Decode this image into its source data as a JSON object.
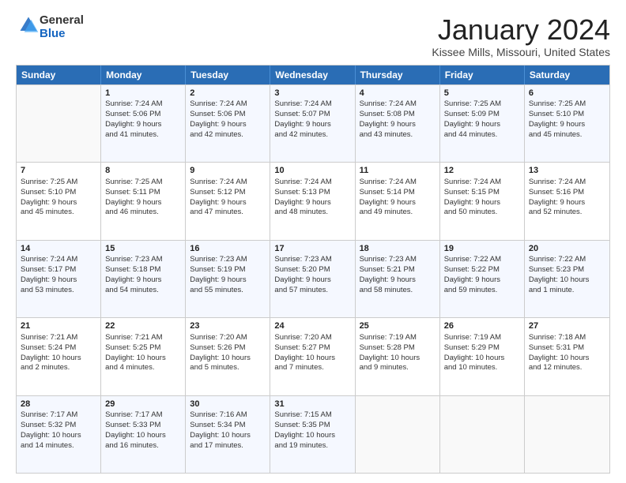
{
  "logo": {
    "general": "General",
    "blue": "Blue"
  },
  "title": "January 2024",
  "location": "Kissee Mills, Missouri, United States",
  "weekdays": [
    "Sunday",
    "Monday",
    "Tuesday",
    "Wednesday",
    "Thursday",
    "Friday",
    "Saturday"
  ],
  "rows": [
    [
      {
        "day": "",
        "lines": []
      },
      {
        "day": "1",
        "lines": [
          "Sunrise: 7:24 AM",
          "Sunset: 5:06 PM",
          "Daylight: 9 hours",
          "and 41 minutes."
        ]
      },
      {
        "day": "2",
        "lines": [
          "Sunrise: 7:24 AM",
          "Sunset: 5:06 PM",
          "Daylight: 9 hours",
          "and 42 minutes."
        ]
      },
      {
        "day": "3",
        "lines": [
          "Sunrise: 7:24 AM",
          "Sunset: 5:07 PM",
          "Daylight: 9 hours",
          "and 42 minutes."
        ]
      },
      {
        "day": "4",
        "lines": [
          "Sunrise: 7:24 AM",
          "Sunset: 5:08 PM",
          "Daylight: 9 hours",
          "and 43 minutes."
        ]
      },
      {
        "day": "5",
        "lines": [
          "Sunrise: 7:25 AM",
          "Sunset: 5:09 PM",
          "Daylight: 9 hours",
          "and 44 minutes."
        ]
      },
      {
        "day": "6",
        "lines": [
          "Sunrise: 7:25 AM",
          "Sunset: 5:10 PM",
          "Daylight: 9 hours",
          "and 45 minutes."
        ]
      }
    ],
    [
      {
        "day": "7",
        "lines": [
          "Sunrise: 7:25 AM",
          "Sunset: 5:10 PM",
          "Daylight: 9 hours",
          "and 45 minutes."
        ]
      },
      {
        "day": "8",
        "lines": [
          "Sunrise: 7:25 AM",
          "Sunset: 5:11 PM",
          "Daylight: 9 hours",
          "and 46 minutes."
        ]
      },
      {
        "day": "9",
        "lines": [
          "Sunrise: 7:24 AM",
          "Sunset: 5:12 PM",
          "Daylight: 9 hours",
          "and 47 minutes."
        ]
      },
      {
        "day": "10",
        "lines": [
          "Sunrise: 7:24 AM",
          "Sunset: 5:13 PM",
          "Daylight: 9 hours",
          "and 48 minutes."
        ]
      },
      {
        "day": "11",
        "lines": [
          "Sunrise: 7:24 AM",
          "Sunset: 5:14 PM",
          "Daylight: 9 hours",
          "and 49 minutes."
        ]
      },
      {
        "day": "12",
        "lines": [
          "Sunrise: 7:24 AM",
          "Sunset: 5:15 PM",
          "Daylight: 9 hours",
          "and 50 minutes."
        ]
      },
      {
        "day": "13",
        "lines": [
          "Sunrise: 7:24 AM",
          "Sunset: 5:16 PM",
          "Daylight: 9 hours",
          "and 52 minutes."
        ]
      }
    ],
    [
      {
        "day": "14",
        "lines": [
          "Sunrise: 7:24 AM",
          "Sunset: 5:17 PM",
          "Daylight: 9 hours",
          "and 53 minutes."
        ]
      },
      {
        "day": "15",
        "lines": [
          "Sunrise: 7:23 AM",
          "Sunset: 5:18 PM",
          "Daylight: 9 hours",
          "and 54 minutes."
        ]
      },
      {
        "day": "16",
        "lines": [
          "Sunrise: 7:23 AM",
          "Sunset: 5:19 PM",
          "Daylight: 9 hours",
          "and 55 minutes."
        ]
      },
      {
        "day": "17",
        "lines": [
          "Sunrise: 7:23 AM",
          "Sunset: 5:20 PM",
          "Daylight: 9 hours",
          "and 57 minutes."
        ]
      },
      {
        "day": "18",
        "lines": [
          "Sunrise: 7:23 AM",
          "Sunset: 5:21 PM",
          "Daylight: 9 hours",
          "and 58 minutes."
        ]
      },
      {
        "day": "19",
        "lines": [
          "Sunrise: 7:22 AM",
          "Sunset: 5:22 PM",
          "Daylight: 9 hours",
          "and 59 minutes."
        ]
      },
      {
        "day": "20",
        "lines": [
          "Sunrise: 7:22 AM",
          "Sunset: 5:23 PM",
          "Daylight: 10 hours",
          "and 1 minute."
        ]
      }
    ],
    [
      {
        "day": "21",
        "lines": [
          "Sunrise: 7:21 AM",
          "Sunset: 5:24 PM",
          "Daylight: 10 hours",
          "and 2 minutes."
        ]
      },
      {
        "day": "22",
        "lines": [
          "Sunrise: 7:21 AM",
          "Sunset: 5:25 PM",
          "Daylight: 10 hours",
          "and 4 minutes."
        ]
      },
      {
        "day": "23",
        "lines": [
          "Sunrise: 7:20 AM",
          "Sunset: 5:26 PM",
          "Daylight: 10 hours",
          "and 5 minutes."
        ]
      },
      {
        "day": "24",
        "lines": [
          "Sunrise: 7:20 AM",
          "Sunset: 5:27 PM",
          "Daylight: 10 hours",
          "and 7 minutes."
        ]
      },
      {
        "day": "25",
        "lines": [
          "Sunrise: 7:19 AM",
          "Sunset: 5:28 PM",
          "Daylight: 10 hours",
          "and 9 minutes."
        ]
      },
      {
        "day": "26",
        "lines": [
          "Sunrise: 7:19 AM",
          "Sunset: 5:29 PM",
          "Daylight: 10 hours",
          "and 10 minutes."
        ]
      },
      {
        "day": "27",
        "lines": [
          "Sunrise: 7:18 AM",
          "Sunset: 5:31 PM",
          "Daylight: 10 hours",
          "and 12 minutes."
        ]
      }
    ],
    [
      {
        "day": "28",
        "lines": [
          "Sunrise: 7:17 AM",
          "Sunset: 5:32 PM",
          "Daylight: 10 hours",
          "and 14 minutes."
        ]
      },
      {
        "day": "29",
        "lines": [
          "Sunrise: 7:17 AM",
          "Sunset: 5:33 PM",
          "Daylight: 10 hours",
          "and 16 minutes."
        ]
      },
      {
        "day": "30",
        "lines": [
          "Sunrise: 7:16 AM",
          "Sunset: 5:34 PM",
          "Daylight: 10 hours",
          "and 17 minutes."
        ]
      },
      {
        "day": "31",
        "lines": [
          "Sunrise: 7:15 AM",
          "Sunset: 5:35 PM",
          "Daylight: 10 hours",
          "and 19 minutes."
        ]
      },
      {
        "day": "",
        "lines": []
      },
      {
        "day": "",
        "lines": []
      },
      {
        "day": "",
        "lines": []
      }
    ]
  ]
}
